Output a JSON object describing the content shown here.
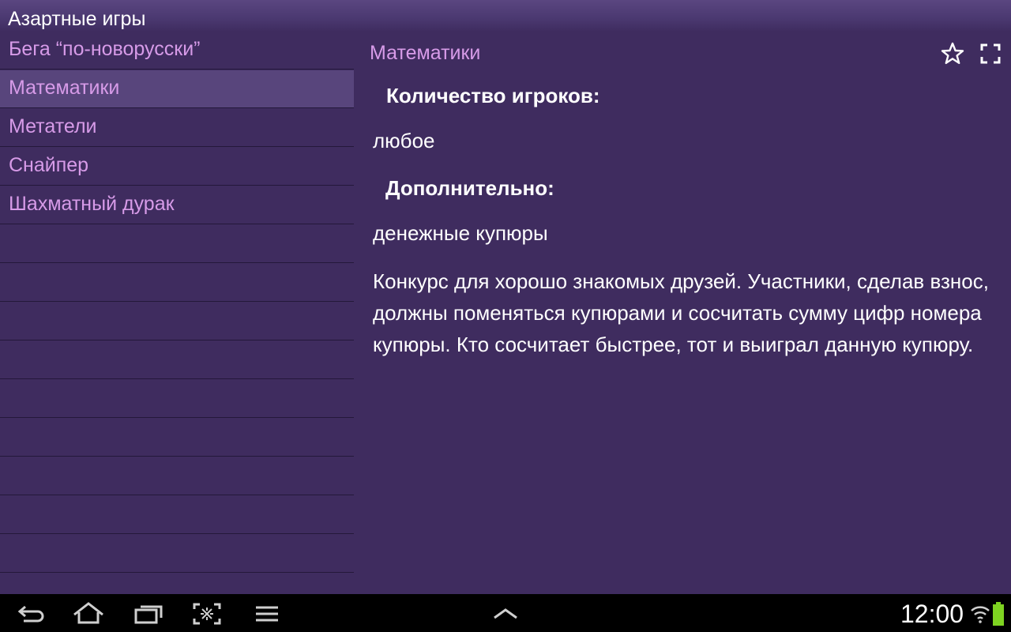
{
  "app": {
    "title": "Азартные игры"
  },
  "list": {
    "items": [
      {
        "label": "Бега “по-новорусски”",
        "selected": false
      },
      {
        "label": "Математики",
        "selected": true
      },
      {
        "label": "Метатели",
        "selected": false
      },
      {
        "label": "Снайпер",
        "selected": false
      },
      {
        "label": "Шахматный дурак",
        "selected": false
      }
    ]
  },
  "detail": {
    "title": "Математики",
    "players_heading": "Количество игроков:",
    "players_value": "любое",
    "extra_heading": "Дополнительно:",
    "extra_value": "денежные купюры",
    "description": "Конкурс для хорошо знакомых друзей. Участники, сделав взнос, должны поменяться купюрами и сосчитать сумму цифр номера купюры. Кто сосчитает быстрее, тот и выиграл данную купюру.",
    "favorite_icon": "star-outline-icon",
    "fullscreen_icon": "fullscreen-icon"
  },
  "navbar": {
    "back_icon": "back-icon",
    "home_icon": "home-icon",
    "recents_icon": "recent-apps-icon",
    "screenshot_icon": "screenshot-icon",
    "menu_icon": "menu-icon",
    "up_icon": "chevron-up-icon",
    "clock": "12:00",
    "wifi_icon": "wifi-icon",
    "battery_icon": "battery-icon"
  },
  "colors": {
    "background": "#3f2c5f",
    "selected_row": "#58457c",
    "accent_text": "#d79be8",
    "text": "#ffffff",
    "navbar": "#000000",
    "battery": "#7ed321"
  }
}
